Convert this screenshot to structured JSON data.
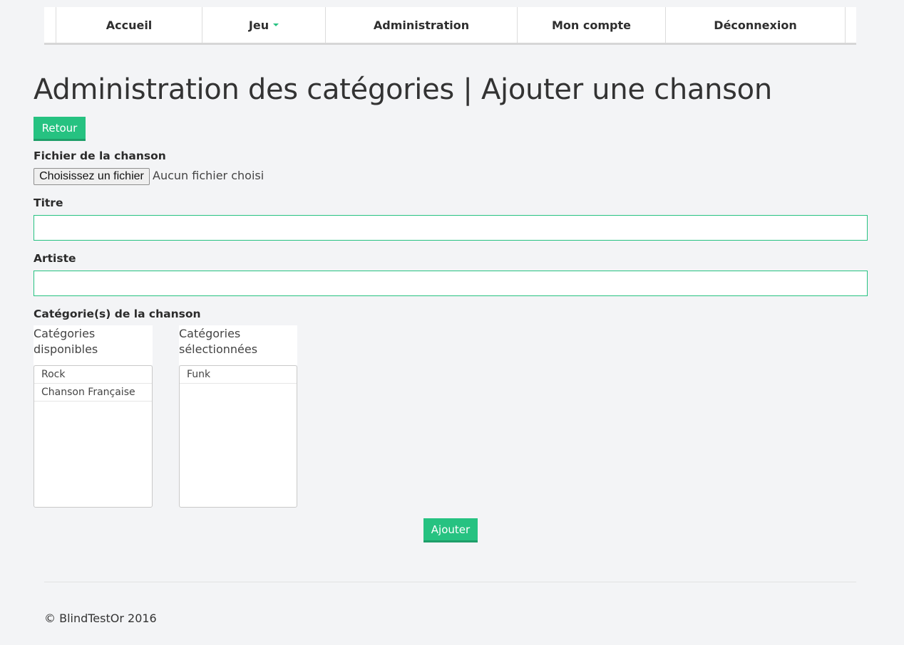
{
  "nav": {
    "items": [
      {
        "label": "Accueil"
      },
      {
        "label": "Jeu"
      },
      {
        "label": "Administration"
      },
      {
        "label": "Mon compte"
      },
      {
        "label": "Déconnexion"
      }
    ]
  },
  "page": {
    "title": "Administration des catégories | Ajouter une chanson",
    "back_button": "Retour"
  },
  "form": {
    "file_label": "Fichier de la chanson",
    "file_button": "Choisissez un fichier",
    "file_status": "Aucun fichier choisi",
    "title_label": "Titre",
    "title_value": "",
    "artist_label": "Artiste",
    "artist_value": "",
    "categories_label": "Catégorie(s) de la chanson",
    "available_header": "Catégories disponibles",
    "available": [
      "Rock",
      "Chanson Française"
    ],
    "selected_header": "Catégories sélectionnées",
    "selected": [
      "Funk"
    ],
    "submit_button": "Ajouter"
  },
  "footer": {
    "copyright": "© BlindTestOr 2016"
  },
  "colors": {
    "accent": "#26c281",
    "background": "#f3f4f6"
  }
}
